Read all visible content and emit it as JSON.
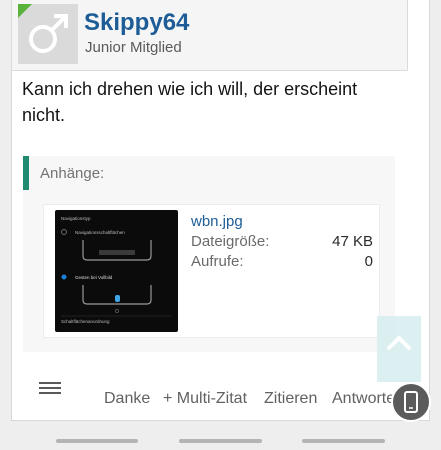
{
  "user": {
    "name": "Skippy64",
    "title": "Junior Mitglied",
    "avatar_icon": "male-symbol-icon"
  },
  "message": {
    "text": "Kann ich drehen wie ich will, der erscheint nicht."
  },
  "attachments": {
    "label": "Anhänge:",
    "items": [
      {
        "file_name": "wbn.jpg",
        "size_label": "Dateigröße:",
        "size_value": "47 KB",
        "views_label": "Aufrufe:",
        "views_value": "0",
        "thumbnail": {
          "heading": "Navigationstyp",
          "option1": "Navigationsschaltflächen",
          "option2": "Gesten bei Vollbild",
          "footer": "Schaltflächenanordnung"
        }
      }
    ]
  },
  "actions": {
    "menu_icon": "hamburger-menu-icon",
    "danke": "Danke",
    "multi_zitat": "+ Multi-Zitat",
    "zitieren": "Zitieren",
    "antworten": "Antworten"
  },
  "colors": {
    "username": "#1d5c96",
    "accent_bar": "#1f8a6f",
    "avatar_corner": "#59b23b"
  }
}
